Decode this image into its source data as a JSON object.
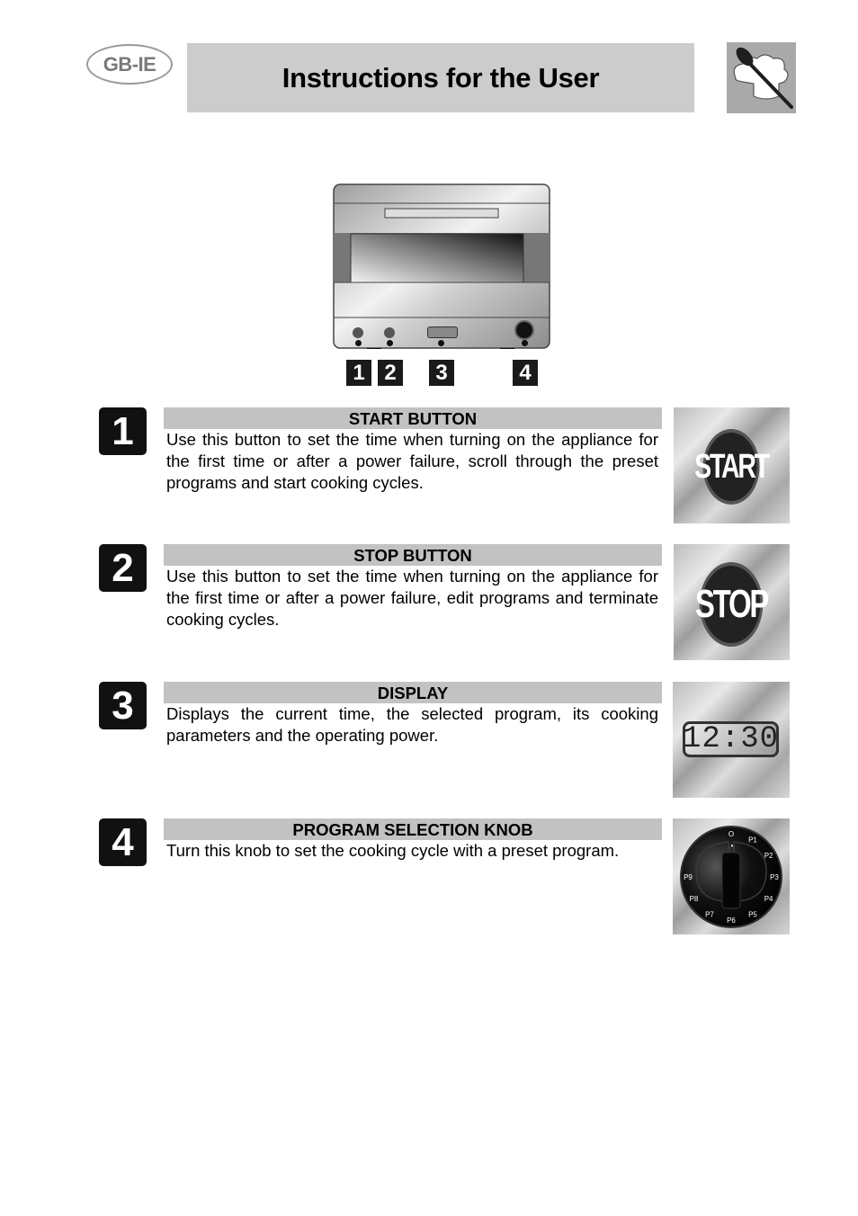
{
  "header": {
    "region_badge": "GB-IE",
    "title": "Instructions for the User",
    "logo_icon": "chef-hat-spoon-icon"
  },
  "diagram": {
    "callouts": [
      "1",
      "2",
      "3",
      "4"
    ],
    "start_label": "START",
    "stop_label": "STOP",
    "display_value": "12:30"
  },
  "sections": [
    {
      "number": "1",
      "heading": "START BUTTON",
      "text": "Use this button to set the time when turning on the appliance for the first time or after a power failure, scroll through the preset programs and start cooking cycles.",
      "image_label": "START"
    },
    {
      "number": "2",
      "heading": "STOP BUTTON",
      "text": "Use this button to set the time when turning on the appliance for the first time or after a power failure, edit programs and terminate cooking cycles.",
      "image_label": "STOP"
    },
    {
      "number": "3",
      "heading": "DISPLAY",
      "text": "Displays the current time, the selected program, its cooking parameters and the operating power.",
      "image_label": "12:30"
    },
    {
      "number": "4",
      "heading": "PROGRAM SELECTION KNOB",
      "text": "Turn this knob to set the cooking cycle with a preset program.",
      "knob_labels": [
        "O",
        "P1",
        "P2",
        "P3",
        "P4",
        "P5",
        "P6",
        "P7",
        "P8",
        "P9"
      ]
    }
  ]
}
